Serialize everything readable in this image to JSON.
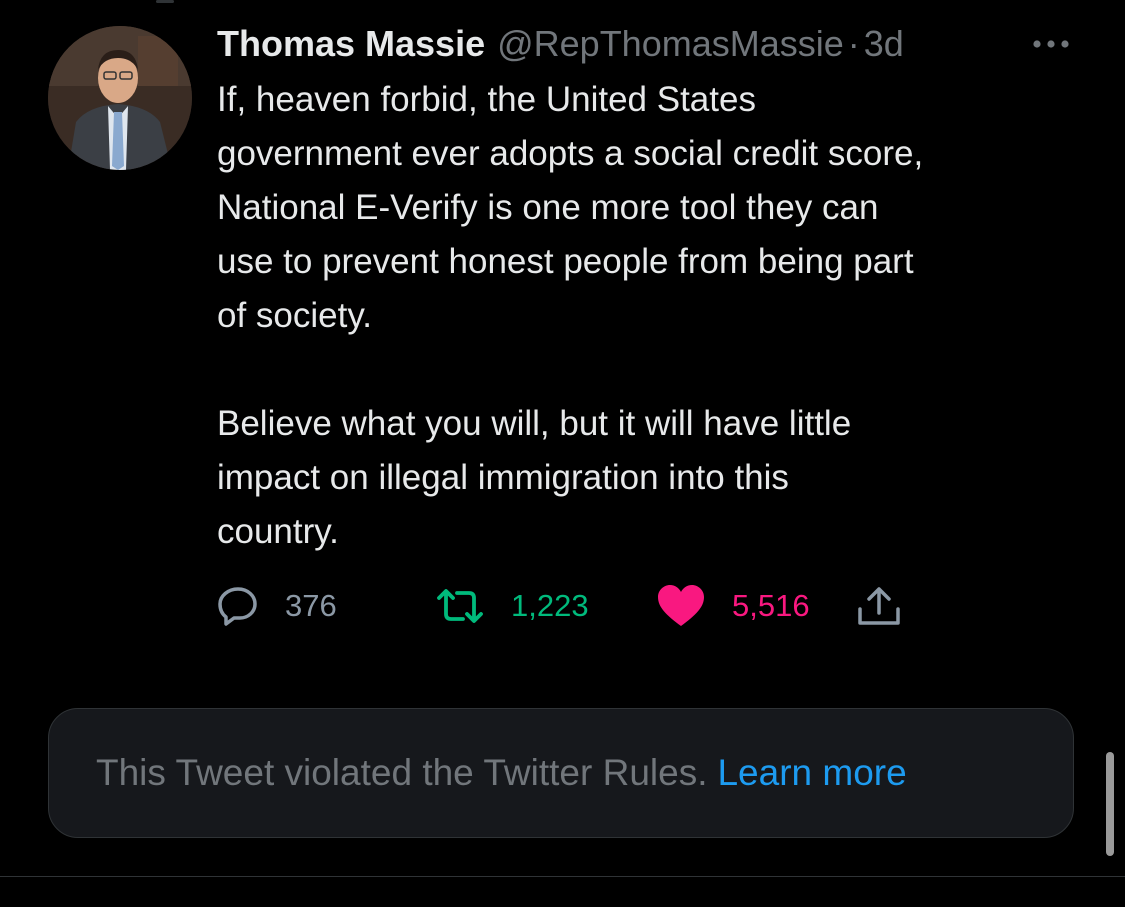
{
  "tweet": {
    "author_name": "Thomas Massie",
    "handle": "@RepThomasMassie",
    "separator": "·",
    "time": "3d",
    "more_icon": "more-horizontal-icon",
    "text": "If, heaven forbid, the United States\ngovernment ever adopts a social credit score,\nNational E-Verify is one more tool they can\nuse to prevent honest people from being part\nof society.\n\nBelieve what you will, but it will have little\nimpact on illegal immigration into this\ncountry.",
    "actions": {
      "reply_count": "376",
      "retweet_count": "1,223",
      "like_count": "5,516"
    }
  },
  "notice": {
    "text": "This Tweet violated the Twitter Rules.",
    "link_label": "Learn more"
  },
  "colors": {
    "background": "#000000",
    "text_primary": "#e7e9ea",
    "text_secondary": "#71767b",
    "retweet_green": "#00ba7c",
    "like_pink": "#f91880",
    "link_blue": "#1d9bf0"
  }
}
